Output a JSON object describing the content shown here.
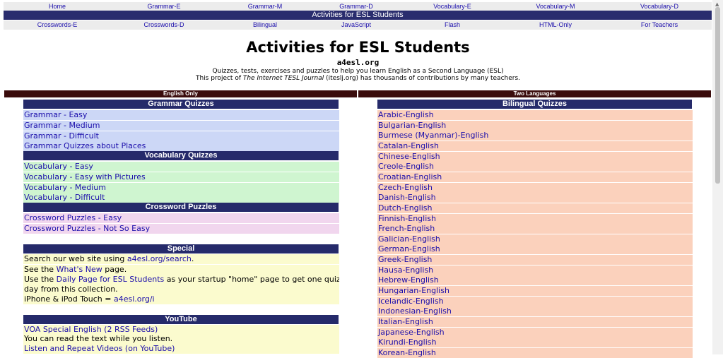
{
  "top_nav": [
    "Home",
    "Grammar-E",
    "Grammar-M",
    "Grammar-D",
    "Vocabulary-E",
    "Vocabulary-M",
    "Vocabulary-D"
  ],
  "banner": "Activities for ESL Students",
  "second_nav": [
    "Crosswords-E",
    "Crosswords-D",
    "Bilingual",
    "JavaScript",
    "Flash",
    "HTML-Only",
    "For Teachers"
  ],
  "header": {
    "title": "Activities for ESL Students",
    "site": "a4esl.org",
    "tagline": "Quizzes, tests, exercises and puzzles to help you learn English as a Second Language (ESL)",
    "project_prefix": "This project of ",
    "project_journal": "The Internet TESL Journal",
    "project_suffix": " (iteslj.org) has thousands of contributions by many teachers."
  },
  "left": {
    "column_label": "English Only",
    "grammar": {
      "title": "Grammar Quizzes",
      "items": [
        "Grammar - Easy",
        "Grammar - Medium",
        "Grammar - Difficult",
        "Grammar Quizzes about Places"
      ]
    },
    "vocabulary": {
      "title": "Vocabulary Quizzes",
      "items": [
        "Vocabulary - Easy",
        "Vocabulary - Easy with Pictures",
        "Vocabulary - Medium",
        "Vocabulary - Difficult"
      ]
    },
    "crossword": {
      "title": "Crossword Puzzles",
      "items": [
        "Crossword Puzzles - Easy",
        "Crossword Puzzles - Not So Easy"
      ]
    },
    "special": {
      "title": "Special",
      "search_pre": "Search our web site using ",
      "search_link": "a4esl.org/search",
      "search_post": ".",
      "whatsnew_pre": "See the ",
      "whatsnew_link": "What's New",
      "whatsnew_post": " page.",
      "daily_pre": "Use the ",
      "daily_link": "Daily Page for ESL Students",
      "daily_post": " as your startup \"home\" page to get one quiz a",
      "daily_line2": "day from this collection.",
      "iphone_pre": "iPhone & iPod Touch = ",
      "iphone_link": "a4esl.org/i"
    },
    "youtube": {
      "title": "YouTube",
      "voa_link": "VOA Special English (2 RSS Feeds)",
      "voa_text": "You can read the text while you listen.",
      "listen_link": "Listen and Repeat Videos (on YouTube)"
    }
  },
  "right": {
    "column_label": "Two Languages",
    "bilingual": {
      "title": "Bilingual Quizzes",
      "items": [
        "Arabic-English",
        "Bulgarian-English",
        "Burmese (Myanmar)-English",
        "Catalan-English",
        "Chinese-English",
        "Creole-English",
        "Croatian-English",
        "Czech-English",
        "Danish-English",
        "Dutch-English",
        "Finnish-English",
        "French-English",
        "Galician-English",
        "German-English",
        "Greek-English",
        "Hausa-English",
        "Hebrew-English",
        "Hungarian-English",
        "Icelandic-English",
        "Indonesian-English",
        "Italian-English",
        "Japanese-English",
        "Kirundi-English",
        "Korean-English"
      ]
    }
  }
}
